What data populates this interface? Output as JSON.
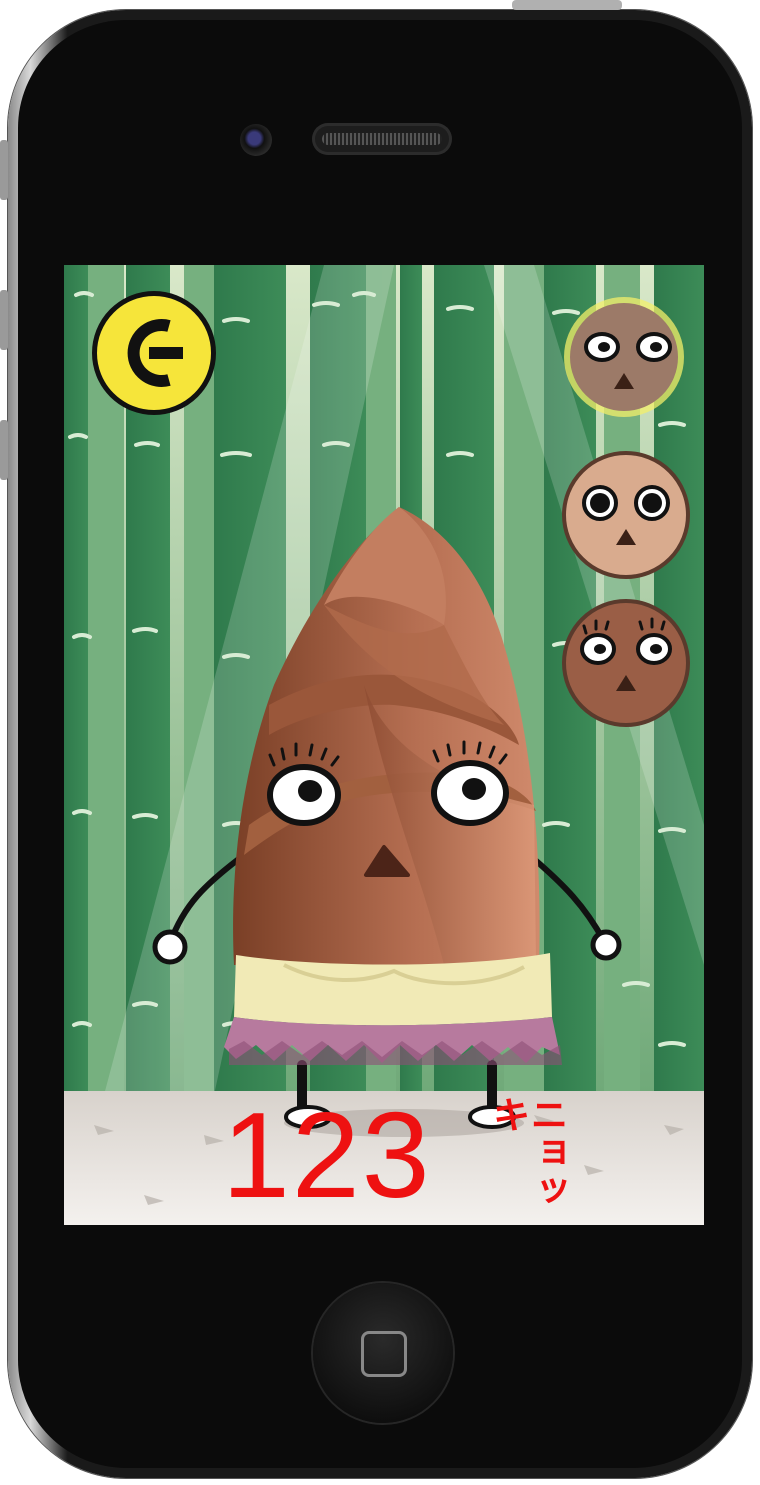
{
  "game": {
    "count": "123",
    "unit": "ニョッキ"
  },
  "icons": {
    "back": "arrow-left-icon"
  },
  "characters": [
    {
      "name": "character-1",
      "selected": true
    },
    {
      "name": "character-2",
      "selected": false
    },
    {
      "name": "character-3",
      "selected": false
    }
  ],
  "colors": {
    "count_text": "#ee1111",
    "back_button": "#f6e53a",
    "selected_ring": "#f3ef6a"
  }
}
